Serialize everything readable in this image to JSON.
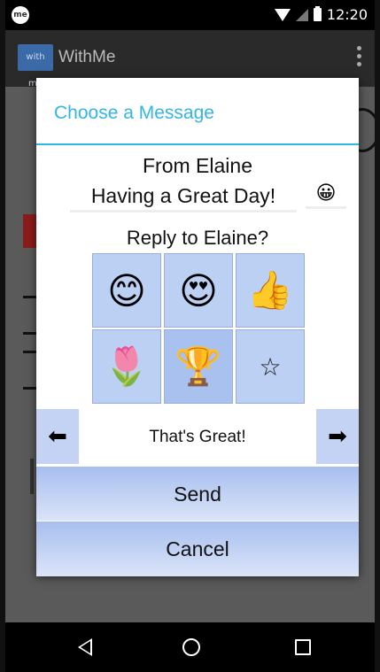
{
  "status_bar": {
    "app_icon_text": "me",
    "time": "12:20"
  },
  "action_bar": {
    "logo_text": "with me",
    "title": "WithMe"
  },
  "dialog": {
    "title": "Choose a Message",
    "from_line": "From Elaine",
    "message": "Having a Great Day!",
    "message_emoji": "😀",
    "reply_prompt": "Reply to Elaine?",
    "emoji_options": [
      "😊",
      "😍",
      "👍",
      "🌷",
      "🏆",
      "☆"
    ],
    "left_arrow": "⬅",
    "right_arrow": "➡",
    "selected_reply": "That's Great!",
    "send_label": "Send",
    "cancel_label": "Cancel"
  }
}
